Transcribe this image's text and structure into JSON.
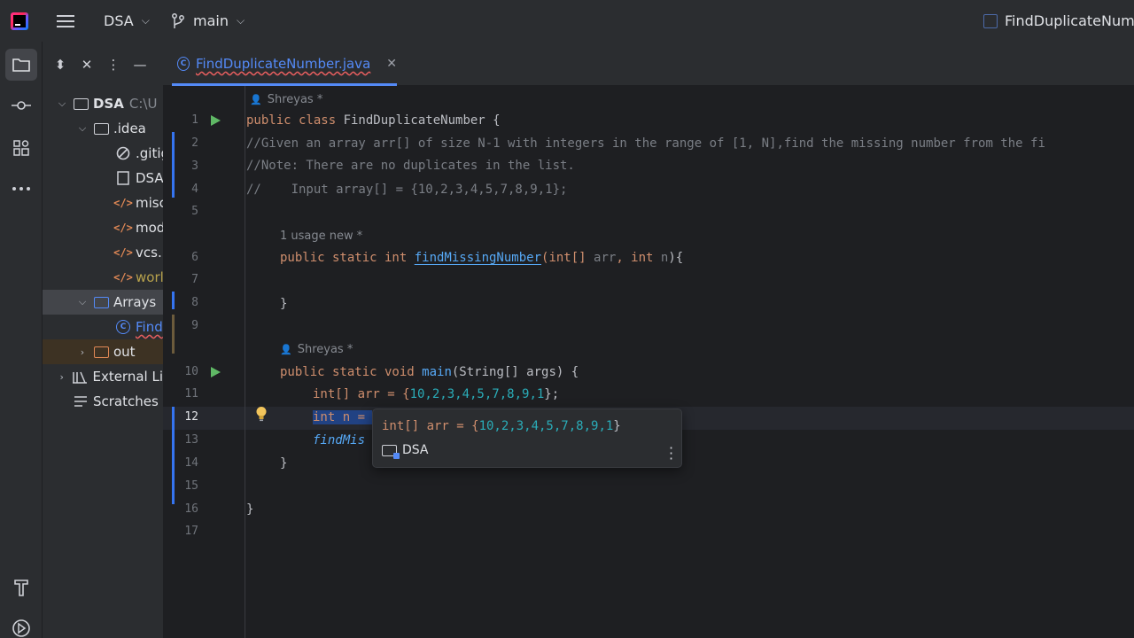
{
  "titlebar": {
    "project": "DSA",
    "branch": "main",
    "file_title": "FindDuplicateNumbe"
  },
  "project_panel": {
    "tree": [
      {
        "label": "DSA",
        "suffix": "C:\\U",
        "level": 0,
        "expanded": true,
        "icon": "module-folder-icon"
      },
      {
        "label": ".idea",
        "level": 1,
        "expanded": true,
        "icon": "folder-icon"
      },
      {
        "label": ".gitig",
        "level": 2,
        "icon": "ignore-icon"
      },
      {
        "label": "DSA",
        "level": 2,
        "icon": "iml-file-icon"
      },
      {
        "label": "misc",
        "level": 2,
        "icon": "xml-file-icon"
      },
      {
        "label": "mod",
        "level": 2,
        "icon": "xml-file-icon"
      },
      {
        "label": "vcs.",
        "level": 2,
        "icon": "xml-file-icon"
      },
      {
        "label": "worl",
        "level": 2,
        "icon": "xml-file-icon"
      },
      {
        "label": "Arrays",
        "level": 1,
        "expanded": true,
        "icon": "source-folder-icon"
      },
      {
        "label": "Find",
        "level": 2,
        "icon": "java-class-icon"
      },
      {
        "label": "out",
        "level": 1,
        "expanded": false,
        "icon": "excluded-folder-icon"
      },
      {
        "label": "External Li",
        "level": 0,
        "expanded": false,
        "icon": "library-icon"
      },
      {
        "label": "Scratches",
        "level": 0,
        "icon": "scratches-icon"
      }
    ]
  },
  "editor": {
    "tab": {
      "name": "FindDuplicateNumber.java"
    },
    "hints": {
      "author_class": "Shreyas *",
      "usage_method": "1 usage   new *",
      "author_main": "Shreyas *"
    },
    "lines": {
      "l1_kw": "public class ",
      "l1_rest": "FindDuplicateNumber {",
      "l2": "//Given an array arr[] of size N-1 with integers in the range of [1, N],find the missing number from the fi",
      "l3": "//Note: There are no duplicates in the list.",
      "l4": "//    Input array[] = {10,2,3,4,5,7,8,9,1};",
      "l6_kw": "public static int ",
      "l6_fn": "findMissingNumber",
      "l6_a": "(int[] ",
      "l6_p1": "arr",
      "l6_b": ", int ",
      "l6_p2": "n",
      "l6_c": "){",
      "l8": "}",
      "l10_kw": "public static void ",
      "l10_fn": "main",
      "l10_rest": "(String[] args) {",
      "l11_a": "int[] arr = {",
      "l11_nums": "10,2,3,4,5,7,8,9,1",
      "l11_b": "};",
      "l12_sel": "int n = ",
      "l13_call": "findMis",
      "l14": "}",
      "l16": "}"
    },
    "line_numbers": [
      "1",
      "2",
      "3",
      "4",
      "5",
      "6",
      "7",
      "8",
      "9",
      "10",
      "11",
      "12",
      "13",
      "14",
      "15",
      "16",
      "17"
    ],
    "popup": {
      "decl_a": "int[] arr = {",
      "decl_nums": "10,2,3,4,5,7,8,9,1",
      "decl_b": "}",
      "module": "DSA"
    }
  }
}
